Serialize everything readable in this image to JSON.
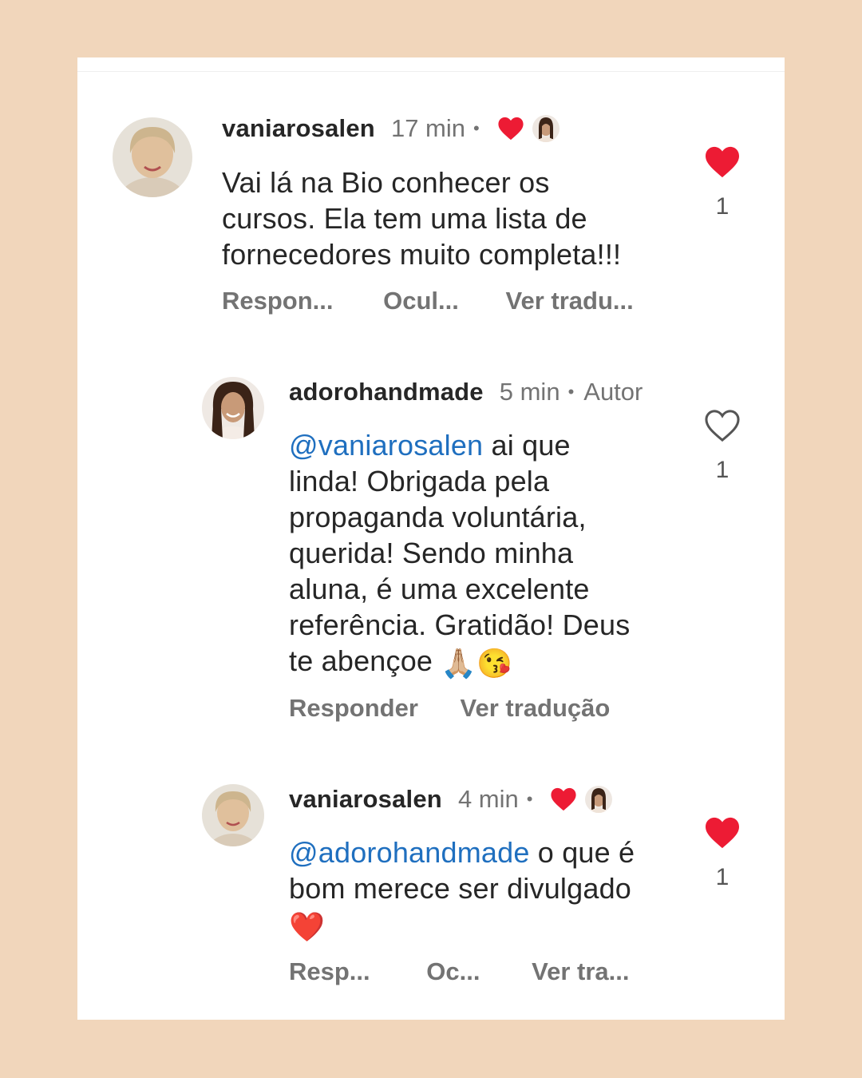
{
  "comments": [
    {
      "username": "vaniarosalen",
      "time": "17 min",
      "separator": "•",
      "text": "Vai lá na Bio conhecer os cursos. Ela tem uma lista de fornecedores muito completa!!!",
      "text_lines": [
        "Vai lá na Bio conhecer os",
        "cursos. Ela tem uma lista de",
        "fornecedores muito completa!!!"
      ],
      "actions": [
        "Respon...",
        "Ocul...",
        "Ver tradu..."
      ],
      "likes": "1",
      "liked": true,
      "creator_liked": true
    },
    {
      "username": "adorohandmade",
      "time": "5 min",
      "separator": "•",
      "badge": "Autor",
      "mention": "@vaniarosalen",
      "text_lines": [
        "ai que",
        "linda! Obrigada pela",
        "propaganda voluntária,",
        "querida! Sendo minha",
        "aluna, é uma excelente",
        "referência. Gratidão! Deus",
        "te abençoe"
      ],
      "emoji": "🙏🏼😘",
      "actions": [
        "Responder",
        "Ver tradução"
      ],
      "likes": "1",
      "liked": false
    },
    {
      "username": "vaniarosalen",
      "time": "4 min",
      "separator": "•",
      "mention": "@adorohandmade",
      "text_lines": [
        "o que é",
        "bom merece ser divulgado"
      ],
      "emoji": "❤️",
      "actions": [
        "Resp...",
        "Oc...",
        "Ver tra..."
      ],
      "likes": "1",
      "liked": true,
      "creator_liked": true
    }
  ],
  "colors": {
    "background": "#f1d6bb",
    "card": "#ffffff",
    "heart_red": "#ed1b34",
    "mention_blue": "#1f6fbf",
    "muted": "#737373"
  },
  "icons": {
    "like_filled": "heart-filled-icon",
    "like_outline": "heart-outline-icon"
  }
}
